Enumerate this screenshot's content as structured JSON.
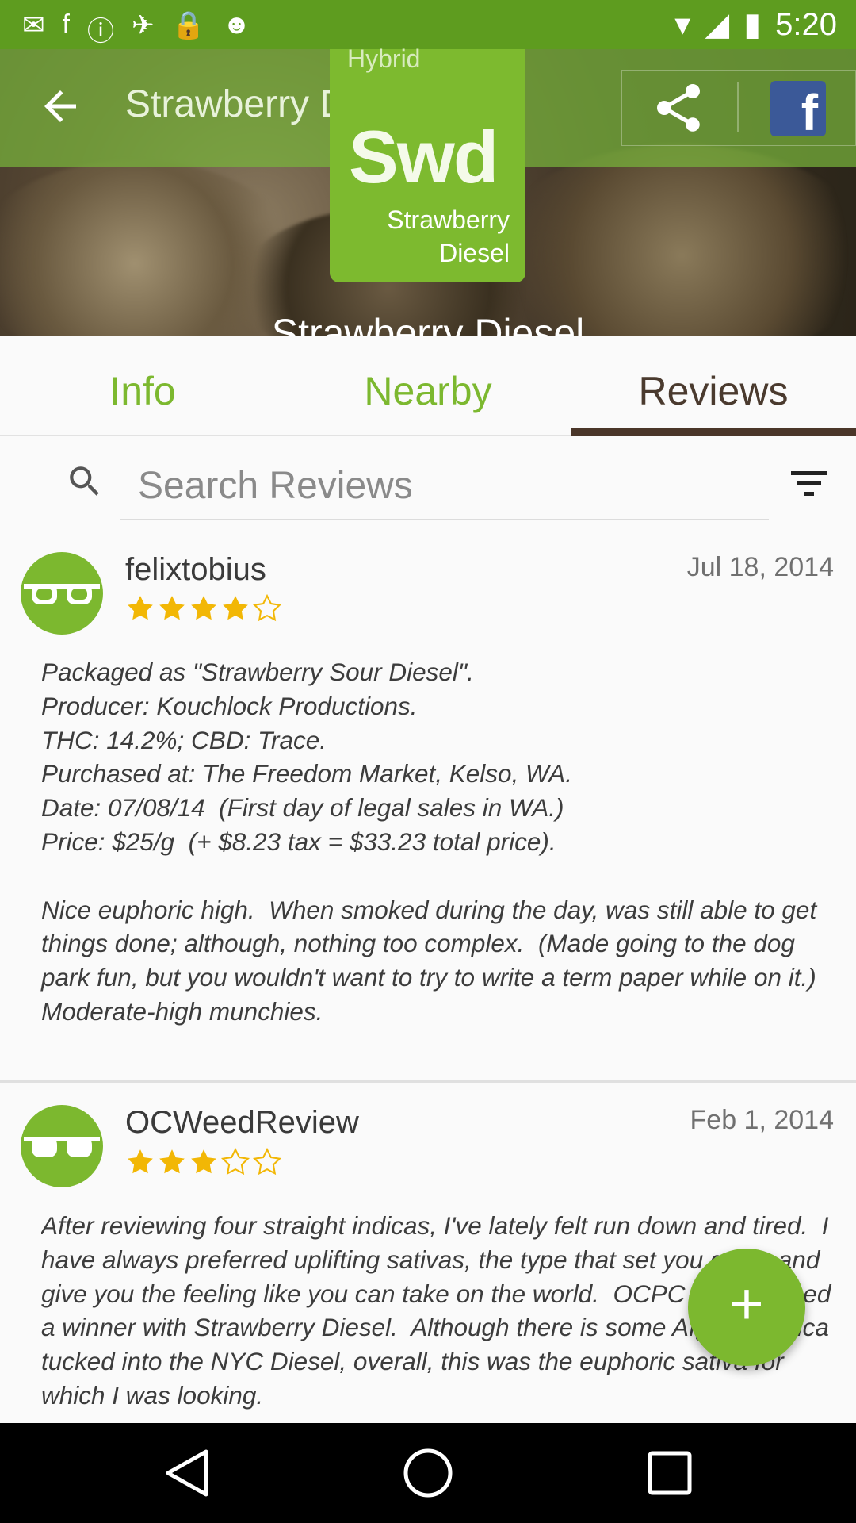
{
  "status_bar": {
    "time": "5:20"
  },
  "appbar": {
    "title": "Strawberry Diesel"
  },
  "logo": {
    "type_label": "Hybrid",
    "abbreviation": "Swd",
    "name_line1": "Strawberry",
    "name_line2": "Diesel"
  },
  "hero": {
    "strain_name": "Strawberry Diesel"
  },
  "tabs": [
    {
      "label": "Info"
    },
    {
      "label": "Nearby"
    },
    {
      "label": "Reviews"
    }
  ],
  "search": {
    "placeholder": "Search Reviews"
  },
  "reviews": [
    {
      "username": "felixtobius",
      "date": "Jul 18, 2014",
      "rating": 4,
      "max_rating": 5,
      "text": "Packaged as \"Strawberry Sour Diesel\".\nProducer: Kouchlock Productions.\nTHC: 14.2%; CBD: Trace.\nPurchased at: The Freedom Market, Kelso, WA.\nDate: 07/08/14  (First day of legal sales in WA.)\nPrice: $25/g  (+ $8.23 tax = $33.23 total price).\n\nNice euphoric high.  When smoked during the day, was still able to get things done; although, nothing too complex.  (Made going to the dog park fun, but you wouldn't want to try to write a term paper while on it.)  Moderate-high munchies."
    },
    {
      "username": "OCWeedReview",
      "date": "Feb 1, 2014",
      "rating": 3,
      "max_rating": 5,
      "text": "After reviewing four straight indicas, I've lately felt run down and tired.  I have always preferred uplifting sativas, the type that set you going and give you the feeling like you can take on the world.  OCPC has grabbed a winner with Strawberry Diesel.  Although there is some Afghani indica tucked into the NYC Diesel, overall, this was the euphoric sativa for which I was looking."
    }
  ],
  "fab": {
    "icon": "plus-icon"
  },
  "colors": {
    "brand_green": "#7cb82f",
    "status_green": "#5e9c1f",
    "tab_active": "#4a3a2e",
    "facebook": "#3b5998"
  }
}
